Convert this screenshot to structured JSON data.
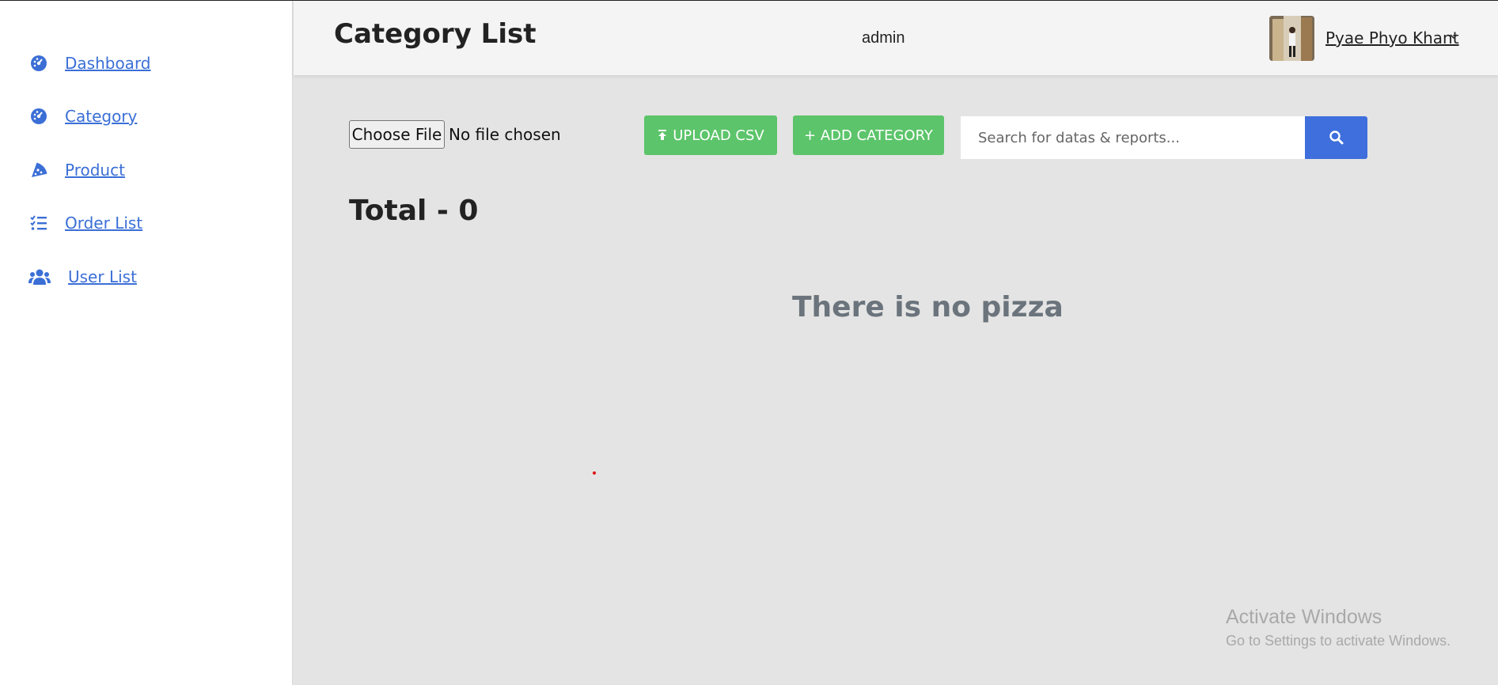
{
  "sidebar": {
    "items": [
      {
        "label": "Dashboard",
        "icon": "dashboard-gauge-icon"
      },
      {
        "label": "Category",
        "icon": "category-gauge-icon"
      },
      {
        "label": "Product",
        "icon": "pizza-slice-icon"
      },
      {
        "label": "Order List",
        "icon": "list-check-icon"
      },
      {
        "label": "User List",
        "icon": "users-icon"
      }
    ]
  },
  "header": {
    "title": "Category List",
    "role": "admin",
    "user_name": "Pyae Phyo Khant"
  },
  "toolbar": {
    "file_button_label": "Choose File",
    "file_status": "No file chosen",
    "upload_label": "UPLOAD CSV",
    "add_label": "+ ADD CATEGORY",
    "search_placeholder": "Search for datas & reports..."
  },
  "main": {
    "total": "Total - 0",
    "empty_message": "There is no pizza"
  },
  "watermark": {
    "title": "Activate Windows",
    "subtitle": "Go to Settings to activate Windows."
  },
  "colors": {
    "accent_blue": "#3e6fdc",
    "button_green": "#5cc46a",
    "link_blue": "#3b6fd6"
  }
}
